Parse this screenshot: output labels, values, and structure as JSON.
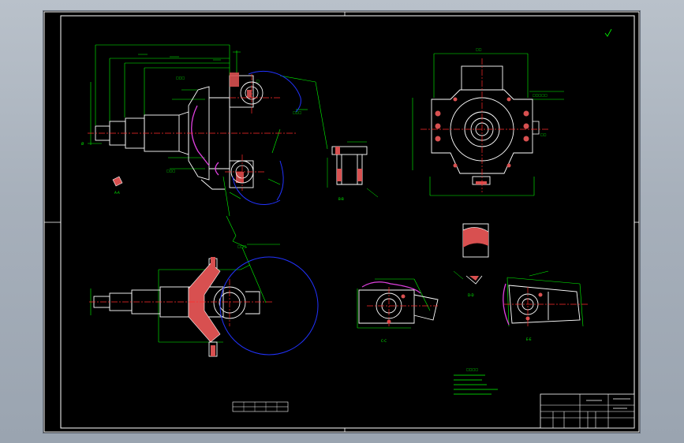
{
  "app": {
    "title": ""
  },
  "colors": {
    "background": "#000000",
    "outline": "#ffffff",
    "dimension": "#00ff00",
    "centerline": "#ff2a2a",
    "circle": "#2233ff",
    "hatch": "#d85050"
  },
  "drawing": {
    "views": [
      "main-view",
      "top-view",
      "side-view",
      "lower-view",
      "section-a",
      "section-b",
      "section-c",
      "section-d",
      "detail-e"
    ],
    "title_block": {
      "visible": true
    }
  }
}
